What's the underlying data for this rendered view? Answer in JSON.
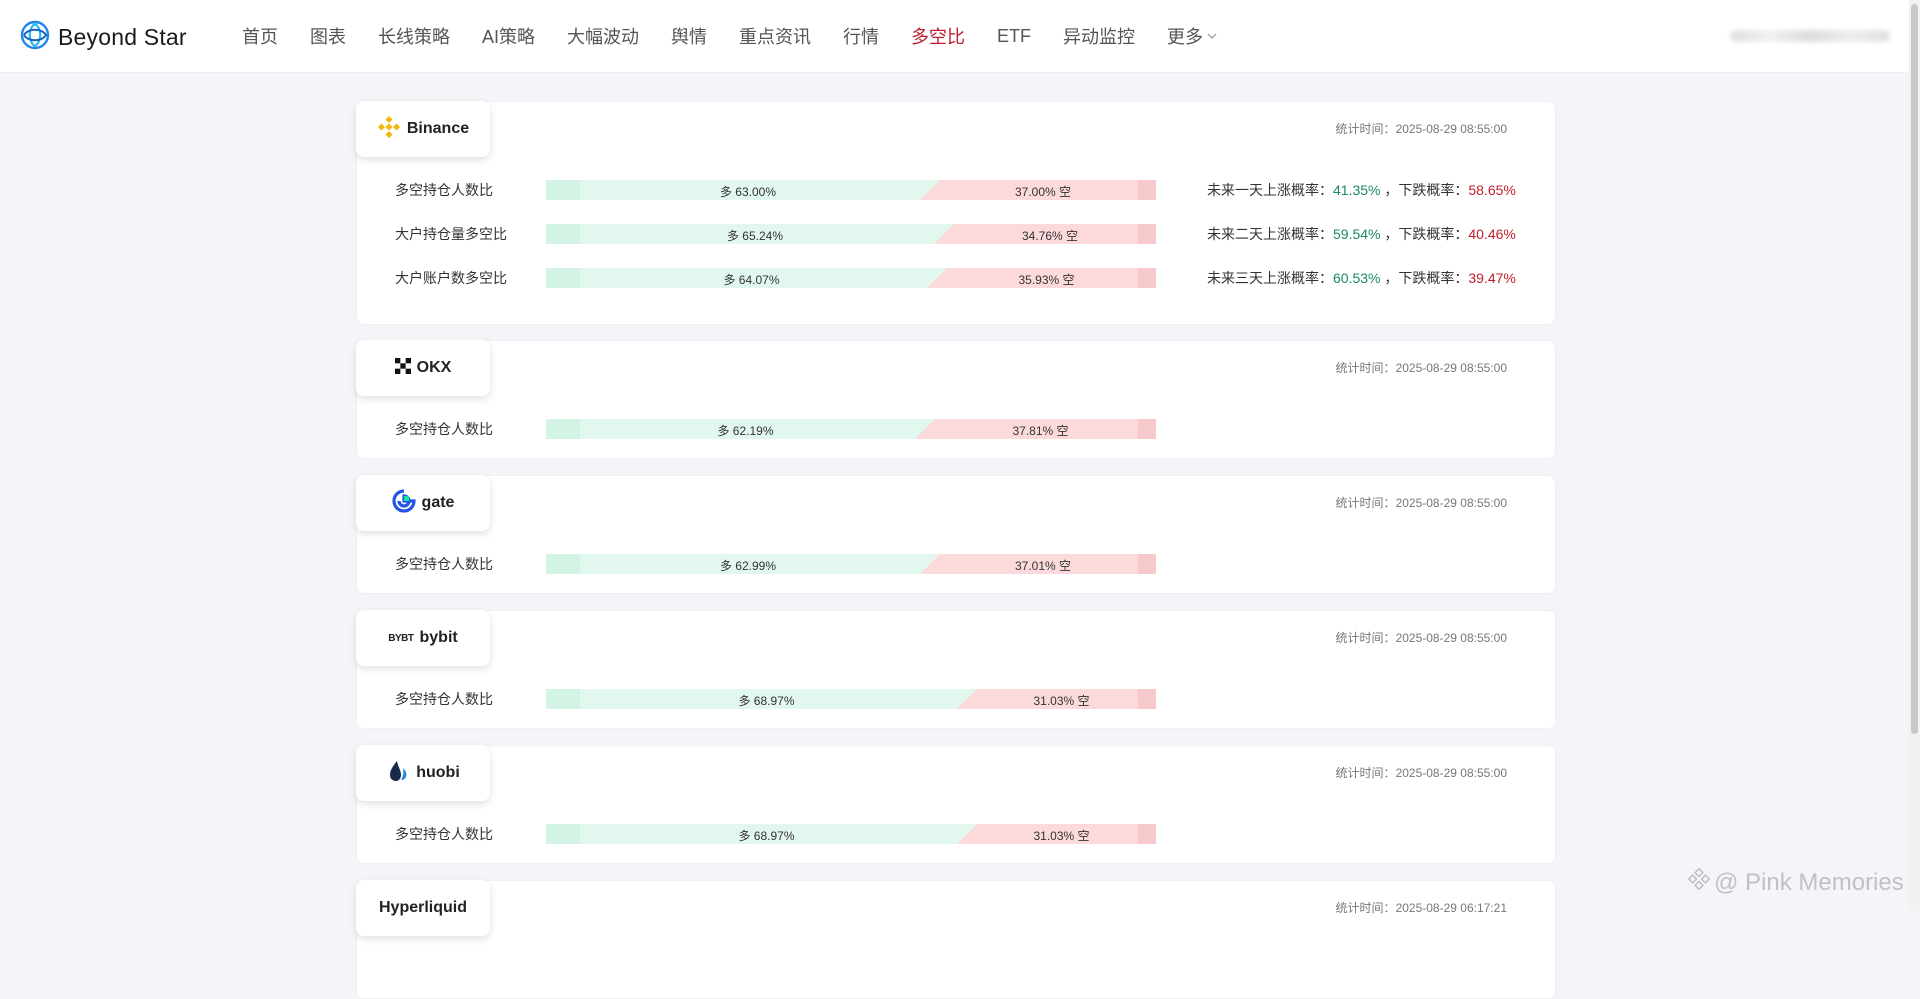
{
  "app": {
    "name": "Beyond Star"
  },
  "nav": [
    {
      "label": "首页"
    },
    {
      "label": "图表"
    },
    {
      "label": "长线策略"
    },
    {
      "label": "AI策略"
    },
    {
      "label": "大幅波动"
    },
    {
      "label": "舆情"
    },
    {
      "label": "重点资讯"
    },
    {
      "label": "行情"
    },
    {
      "label": "多空比",
      "active": true
    },
    {
      "label": "ETF"
    },
    {
      "label": "异动监控"
    },
    {
      "label": "更多"
    }
  ],
  "time_prefix": "统计时间：",
  "long_prefix": "多 ",
  "short_suffix": " 空",
  "exchanges": [
    {
      "name": "Binance",
      "stat_time": "2025-08-29 08:55:00",
      "rows": [
        {
          "label": "多空持仓人数比",
          "long": 63.0,
          "long_text": "63.00%",
          "short_text": "37.00%"
        },
        {
          "label": "大户持仓量多空比",
          "long": 65.24,
          "long_text": "65.24%",
          "short_text": "34.76%"
        },
        {
          "label": "大户账户数多空比",
          "long": 64.07,
          "long_text": "64.07%",
          "short_text": "35.93%"
        }
      ],
      "forecast": [
        {
          "label": "未来一天上涨概率：",
          "up": "41.35%",
          "down_label": "下跌概率：",
          "down": "58.65%"
        },
        {
          "label": "未来二天上涨概率：",
          "up": "59.54%",
          "down_label": "下跌概率：",
          "down": "40.46%"
        },
        {
          "label": "未来三天上涨概率：",
          "up": "60.53%",
          "down_label": "下跌概率：",
          "down": "39.47%"
        }
      ]
    },
    {
      "name": "OKX",
      "stat_time": "2025-08-29 08:55:00",
      "rows": [
        {
          "label": "多空持仓人数比",
          "long": 62.19,
          "long_text": "62.19%",
          "short_text": "37.81%"
        }
      ]
    },
    {
      "name": "gate",
      "stat_time": "2025-08-29 08:55:00",
      "rows": [
        {
          "label": "多空持仓人数比",
          "long": 62.99,
          "long_text": "62.99%",
          "short_text": "37.01%"
        }
      ]
    },
    {
      "name": "bybit",
      "logo_text": "BYBT",
      "stat_time": "2025-08-29 08:55:00",
      "rows": [
        {
          "label": "多空持仓人数比",
          "long": 68.97,
          "long_text": "68.97%",
          "short_text": "31.03%"
        }
      ]
    },
    {
      "name": "huobi",
      "stat_time": "2025-08-29 08:55:00",
      "rows": [
        {
          "label": "多空持仓人数比",
          "long": 68.97,
          "long_text": "68.97%",
          "short_text": "31.03%"
        }
      ]
    },
    {
      "name": "Hyperliquid",
      "stat_time": "2025-08-29 06:17:21",
      "rows": []
    }
  ],
  "watermark": "@ Pink Memories",
  "colors": {
    "accent_red": "#c01e2c",
    "up_green": "#1a8a5c",
    "long_bg": "#e2f8ee",
    "short_bg": "#fcdadb",
    "brand_blue": "#1e88e5",
    "binance_gold": "#f0b90b"
  }
}
